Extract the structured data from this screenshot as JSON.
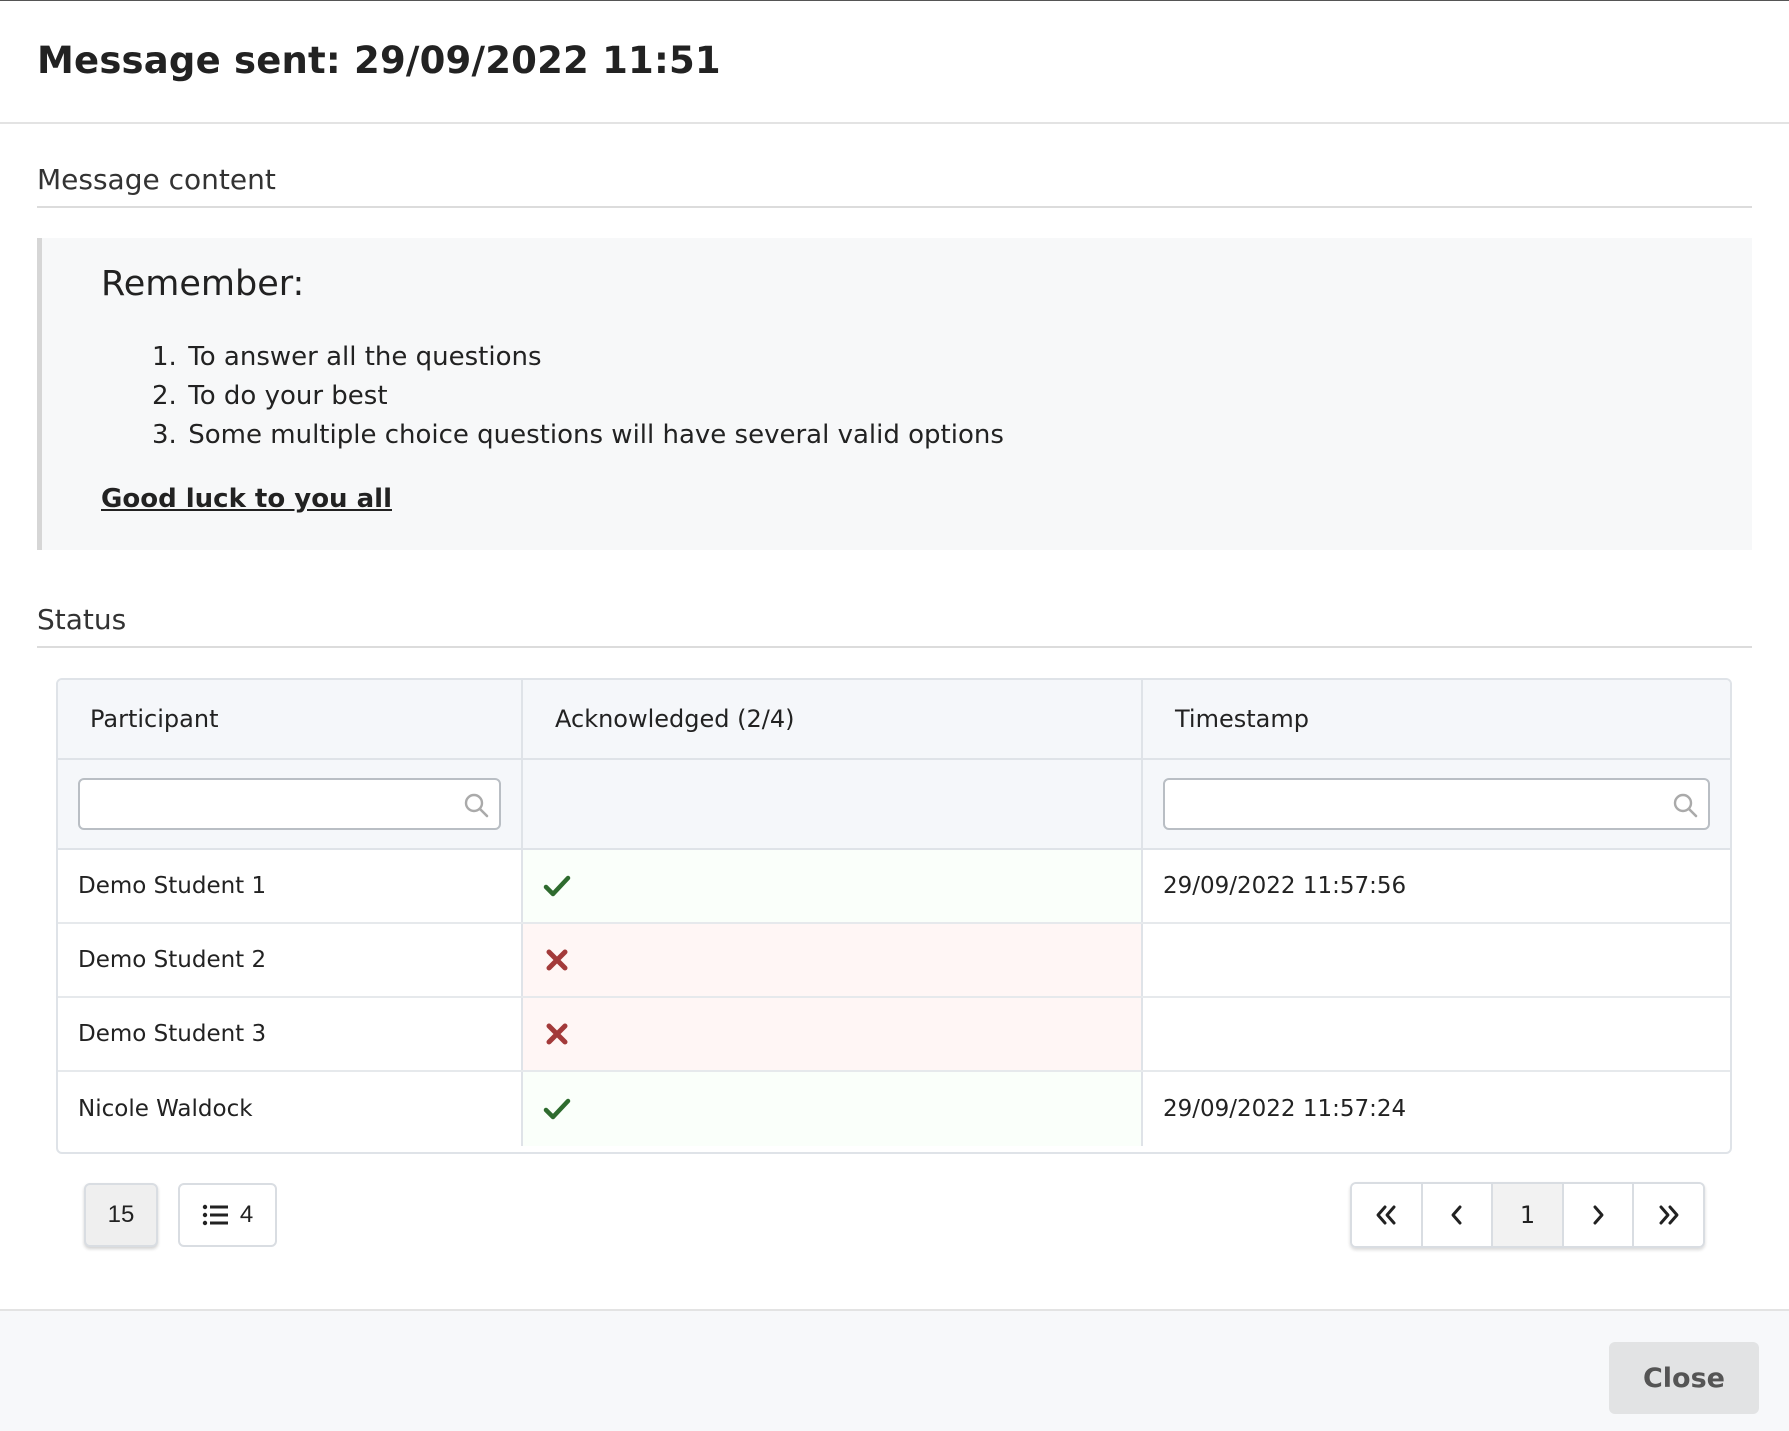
{
  "header": {
    "title": "Message sent: 29/09/2022 11:51"
  },
  "content_section": {
    "heading": "Message content"
  },
  "message": {
    "heading": "Remember:",
    "items": [
      {
        "num": "1.",
        "text": "To answer all the questions"
      },
      {
        "num": "2.",
        "text": "To do your best"
      },
      {
        "num": "3.",
        "text": "Some multiple choice questions will have several valid options"
      }
    ],
    "footer": "Good luck to you all"
  },
  "status_section": {
    "heading": "Status"
  },
  "table": {
    "columns": [
      "Participant",
      "Acknowledged (2/4)",
      "Timestamp"
    ],
    "rows": [
      {
        "participant": "Demo Student 1",
        "acknowledged": "check-icon",
        "timestamp": "29/09/2022 11:57:56"
      },
      {
        "participant": "Demo Student 2",
        "acknowledged": "cross-icon",
        "timestamp": ""
      },
      {
        "participant": "Demo Student 3",
        "acknowledged": "cross-icon",
        "timestamp": ""
      },
      {
        "participant": "Nicole Waldock",
        "acknowledged": "check-icon",
        "timestamp": "29/09/2022 11:57:24"
      }
    ],
    "filters": {
      "participant_value": "",
      "timestamp_value": ""
    }
  },
  "pagination": {
    "page_size": "15",
    "row_count": "4",
    "current_page": "1",
    "first_icon": "double-chevron-left-icon",
    "prev_icon": "chevron-left-icon",
    "next_icon": "chevron-right-icon",
    "last_icon": "double-chevron-right-icon"
  },
  "footer": {
    "close_label": "Close"
  },
  "colors": {
    "check": "#2e6b2e",
    "cross": "#a33a3a",
    "ack_yes_bg": "#fafffa",
    "ack_no_bg": "#fff6f5"
  }
}
